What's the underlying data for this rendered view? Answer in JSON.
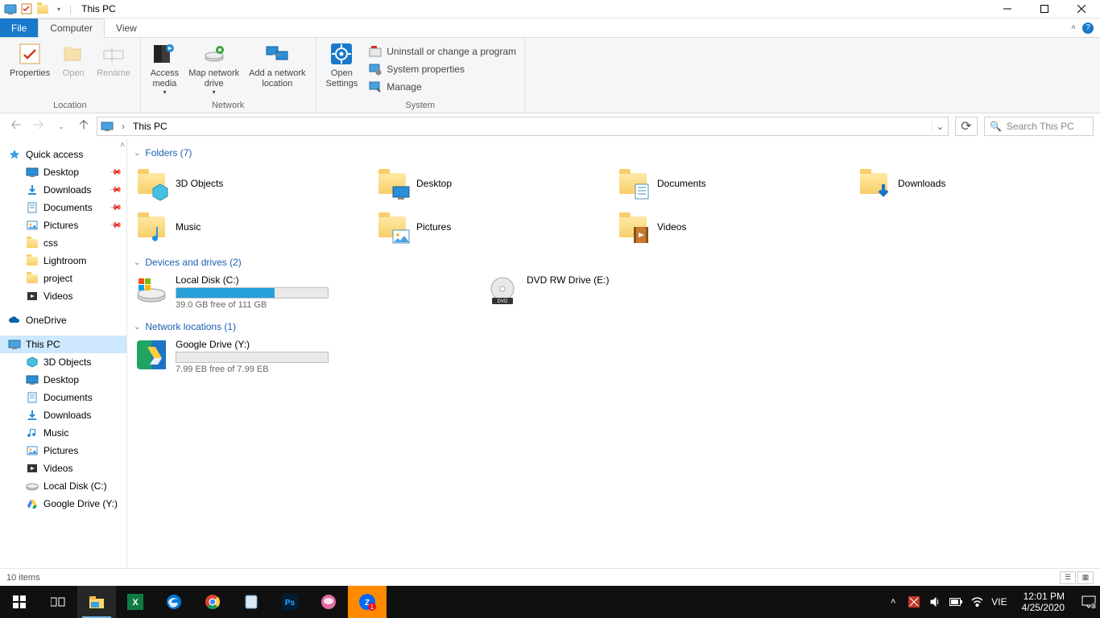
{
  "window": {
    "title": "This PC"
  },
  "tabs": {
    "file": "File",
    "computer": "Computer",
    "view": "View"
  },
  "ribbon": {
    "location": {
      "label": "Location",
      "properties": "Properties",
      "open": "Open",
      "rename": "Rename"
    },
    "network": {
      "label": "Network",
      "access_media": "Access\nmedia",
      "map_drive": "Map network\ndrive",
      "add_location": "Add a network\nlocation"
    },
    "system": {
      "label": "System",
      "open_settings": "Open\nSettings",
      "uninstall": "Uninstall or change a program",
      "sysprops": "System properties",
      "manage": "Manage"
    }
  },
  "address": {
    "path": "This PC",
    "search_placeholder": "Search This PC"
  },
  "sidebar": {
    "quick_access": "Quick access",
    "qa_items": [
      {
        "label": "Desktop",
        "pin": true
      },
      {
        "label": "Downloads",
        "pin": true
      },
      {
        "label": "Documents",
        "pin": true
      },
      {
        "label": "Pictures",
        "pin": true
      },
      {
        "label": "css",
        "pin": false
      },
      {
        "label": "Lightroom",
        "pin": false
      },
      {
        "label": "project",
        "pin": false
      },
      {
        "label": "Videos",
        "pin": false
      }
    ],
    "onedrive": "OneDrive",
    "thispc": "This PC",
    "pc_items": [
      "3D Objects",
      "Desktop",
      "Documents",
      "Downloads",
      "Music",
      "Pictures",
      "Videos",
      "Local Disk (C:)",
      "Google Drive (Y:)"
    ]
  },
  "groups": {
    "folders": {
      "header": "Folders (7)",
      "items": [
        "3D Objects",
        "Desktop",
        "Documents",
        "Downloads",
        "Music",
        "Pictures",
        "Videos"
      ]
    },
    "drives": {
      "header": "Devices and drives (2)",
      "items": [
        {
          "name": "Local Disk (C:)",
          "free": "39.0 GB free of 111 GB",
          "fill_pct": 65
        },
        {
          "name": "DVD RW Drive (E:)",
          "free": "",
          "fill_pct": null
        }
      ]
    },
    "netloc": {
      "header": "Network locations (1)",
      "items": [
        {
          "name": "Google Drive (Y:)",
          "free": "7.99 EB free of 7.99 EB",
          "fill_pct": 0
        }
      ]
    }
  },
  "status": {
    "items": "10 items"
  },
  "taskbar": {
    "lang": "VIE",
    "time": "12:01 PM",
    "date": "4/25/2020"
  }
}
